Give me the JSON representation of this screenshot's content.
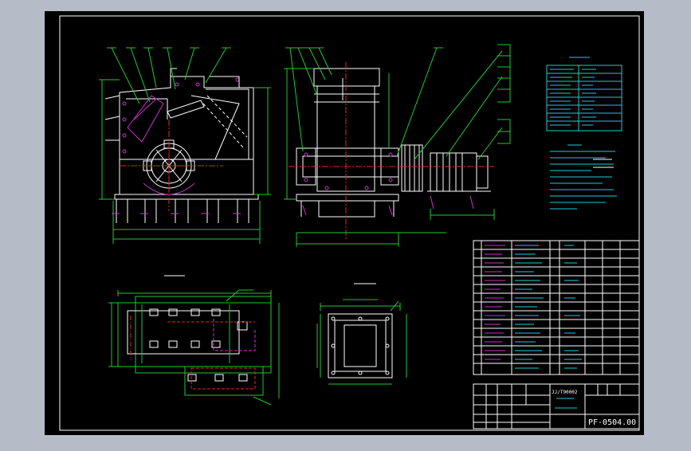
{
  "drawing": {
    "drawing_number": "PF-0504.00",
    "ref_code": "JJ/T90002",
    "colors": {
      "background": "#000000",
      "frame": "#ffffff",
      "green": "#22c832",
      "cyan": "#22c8dc",
      "magenta": "#c832c8",
      "red": "#dc2828",
      "yellow": "#e6d232",
      "white": "#ffffff"
    }
  }
}
